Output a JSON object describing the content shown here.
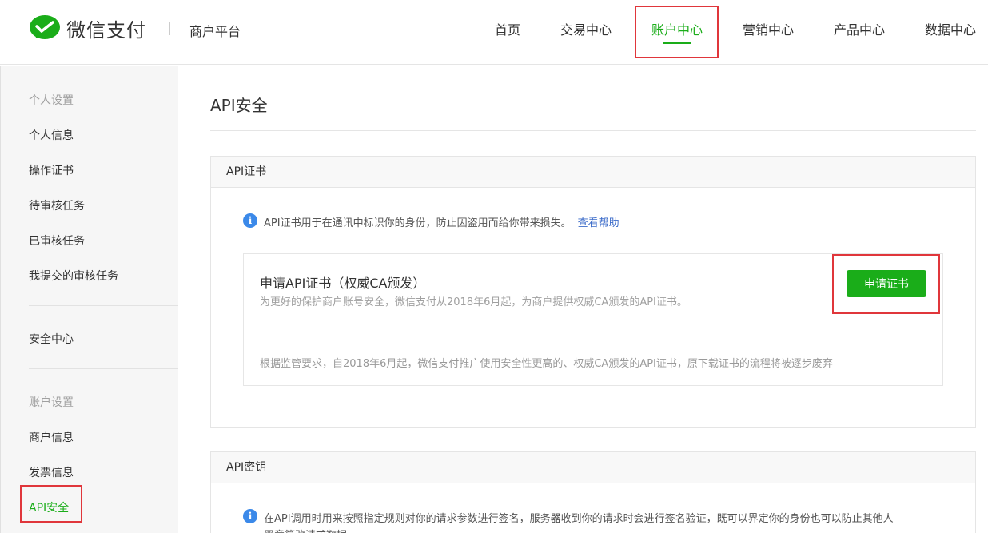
{
  "header": {
    "brand": "微信支付",
    "platform": "商户平台",
    "nav": [
      "首页",
      "交易中心",
      "账户中心",
      "营销中心",
      "产品中心",
      "数据中心"
    ],
    "active_nav": "账户中心"
  },
  "sidebar": {
    "group1": "个人设置",
    "items1": [
      "个人信息",
      "操作证书",
      "待审核任务",
      "已审核任务",
      "我提交的审核任务"
    ],
    "security": "安全中心",
    "group2": "账户设置",
    "items2": [
      "商户信息",
      "发票信息",
      "API安全"
    ],
    "active_item": "API安全"
  },
  "main": {
    "title": "API安全",
    "cert_panel": {
      "header": "API证书",
      "info": "API证书用于在通讯中标识你的身份，防止因盗用而给你带来损失。",
      "help_link": "查看帮助",
      "apply_title": "申请API证书（权威CA颁发）",
      "apply_desc": "为更好的保护商户账号安全，微信支付从2018年6月起，为商户提供权威CA颁发的API证书。",
      "apply_button": "申请证书",
      "note": "根据监管要求，自2018年6月起，微信支付推广使用安全性更高的、权威CA颁发的API证书，原下载证书的流程将被逐步废弃"
    },
    "key_panel": {
      "header": "API密钥",
      "info_line1": "在API调用时用来按照指定规则对你的请求参数进行签名，服务器收到你的请求时会进行签名验证，既可以界定你的身份也可以防止其他人",
      "info_line2": "恶意篡改请求数据"
    }
  },
  "colors": {
    "brand_green": "#1aad19",
    "highlight_red": "#e0363b",
    "info_blue": "#3b89e9",
    "link_blue": "#3b6bc9"
  },
  "icons": [
    "wechat-pay-logo-icon",
    "info-icon"
  ]
}
